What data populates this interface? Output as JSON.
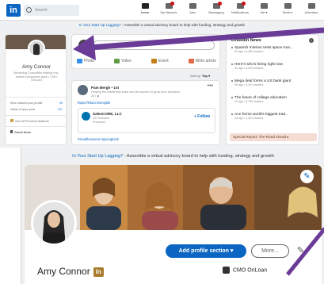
{
  "top": {
    "nav": {
      "logo": "in",
      "search_placeholder": "Search",
      "items": [
        {
          "label": "Home",
          "icon": "home-icon",
          "active": true,
          "badge": false
        },
        {
          "label": "My Network",
          "icon": "network-icon",
          "active": false,
          "badge": true
        },
        {
          "label": "Jobs",
          "icon": "jobs-icon",
          "active": false,
          "badge": false
        },
        {
          "label": "Messaging",
          "icon": "messaging-icon",
          "active": false,
          "badge": true
        },
        {
          "label": "Notifications",
          "icon": "bell-icon",
          "active": false,
          "badge": true
        },
        {
          "label": "Me ▾",
          "icon": "me-icon",
          "active": false,
          "badge": false
        },
        {
          "label": "Work ▾",
          "icon": "grid-icon",
          "active": false,
          "badge": false
        },
        {
          "label": "Advertise",
          "icon": "advertise-icon",
          "active": false,
          "badge": false
        }
      ]
    },
    "banner": {
      "link": "In Your Start Up Lagging?",
      "text": " - Assemble a virtual advisory board to help with funding, strategy and growth"
    },
    "profile": {
      "name": "Amy Connor",
      "headline": "Marketing Consultant helping mid-market companies grow • CMO OnLoan",
      "views_label": "Who viewed your profile",
      "views_value": "99",
      "post_views_label": "Views of your post",
      "post_views_value": "227",
      "premium": "See all Premium features",
      "saved": "Saved items"
    },
    "share": {
      "actions": [
        "Photo",
        "Video",
        "Event",
        "Write article"
      ]
    },
    "sort": {
      "label": "Sort by:",
      "value": "Top ▾"
    },
    "post": {
      "author": "Pam Bergh • 1st",
      "desc": "Helping the leadership team and its reporter to grow your business",
      "time": "2d • ◉",
      "link": "https://lnkd.in/e2nQBk",
      "company": "SalesCORE, LLC",
      "company_sub": "207 followers",
      "company_sub2": "Promoted",
      "follow": "+ Follow",
      "tags": "#smallbusiness #givingback"
    },
    "news": {
      "title": "LinkedIn News",
      "items": [
        {
          "t": "Spanish mission tests space tour...",
          "m": "2h ago • 6,489 readers"
        },
        {
          "t": "Here's who's hiring right now",
          "m": "2h ago • 6,093 readers"
        },
        {
          "t": "Mega deal forms a US bank giant",
          "m": "6h ago • 3,201 readers"
        },
        {
          "t": "The future of college education",
          "m": "1h ago • 2,790 readers"
        },
        {
          "t": "Ace forms world's biggest trad...",
          "m": "2d ago • 1,021 readers"
        }
      ],
      "special": "Special Report: The Road Ahead ▸"
    }
  },
  "bottom": {
    "banner": {
      "link": "In Your Start Up Lagging?",
      "text": " - Assemble a virtual advisory board to help with funding, strategy and growth"
    },
    "add_section": "Add profile section ▾",
    "more": "More...",
    "name": "Amy Connor",
    "in_badge": "in",
    "company": "CMO OnLoan"
  },
  "colors": {
    "brand": "#0a66c2",
    "arrow": "#6a3b97",
    "badge": "#cc1016"
  }
}
